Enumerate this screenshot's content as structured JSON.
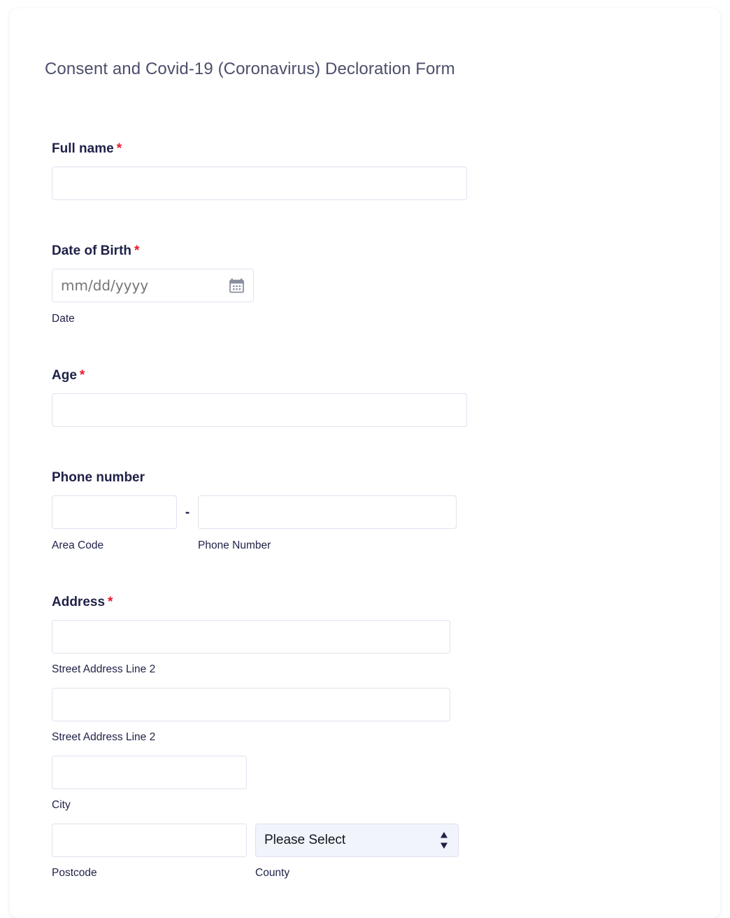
{
  "form": {
    "title": "Consent and Covid-19 (Coronavirus) Decloration Form",
    "required_marker": "*",
    "colors": {
      "label": "#1f2147",
      "title": "#4c4f6b",
      "required": "#e8192c",
      "input_border": "#dfe3ef",
      "select_background": "#f1f4fa",
      "page_background": "#ffffff"
    }
  },
  "fields": {
    "full_name": {
      "label": "Full name",
      "required": true,
      "value": "",
      "placeholder": ""
    },
    "date_of_birth": {
      "label": "Date of Birth",
      "required": true,
      "value": "",
      "placeholder": "mm/dd/yyyy",
      "sublabel": "Date",
      "icon": "calendar-icon"
    },
    "age": {
      "label": "Age",
      "required": true,
      "value": "",
      "placeholder": ""
    },
    "phone_number": {
      "label": "Phone number",
      "required": false,
      "separator": "-",
      "area_code": {
        "value": "",
        "placeholder": "",
        "sublabel": "Area Code"
      },
      "number": {
        "value": "",
        "placeholder": "",
        "sublabel": "Phone Number"
      }
    },
    "address": {
      "label": "Address",
      "required": true,
      "street_line_1": {
        "value": "",
        "placeholder": "",
        "sublabel": "Street Address Line 2"
      },
      "street_line_2": {
        "value": "",
        "placeholder": "",
        "sublabel": "Street Address Line 2"
      },
      "city": {
        "value": "",
        "placeholder": "",
        "sublabel": "City"
      },
      "postcode": {
        "value": "",
        "placeholder": "",
        "sublabel": "Postcode"
      },
      "county": {
        "selected": "Please Select",
        "sublabel": "County",
        "options": [
          "Please Select"
        ]
      }
    }
  }
}
